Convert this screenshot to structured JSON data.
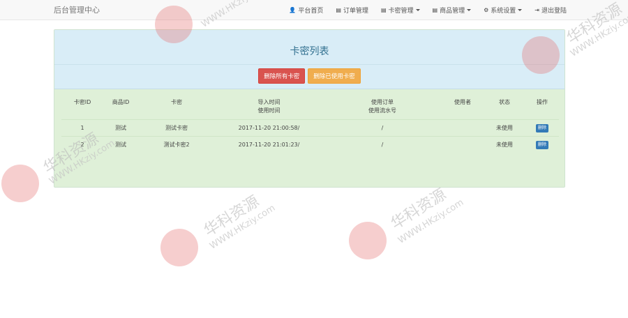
{
  "navbar": {
    "brand": "后台管理中心",
    "items": [
      {
        "icon": "user-icon",
        "glyph": "👤",
        "label": "平台首页",
        "dropdown": false
      },
      {
        "icon": "list-icon",
        "glyph": "▤",
        "label": "订单管理",
        "dropdown": false
      },
      {
        "icon": "list-icon",
        "glyph": "▤",
        "label": "卡密管理",
        "dropdown": true
      },
      {
        "icon": "list-icon",
        "glyph": "▤",
        "label": "商品管理",
        "dropdown": true
      },
      {
        "icon": "gear-icon",
        "glyph": "⚙",
        "label": "系统设置",
        "dropdown": true
      },
      {
        "icon": "logout-icon",
        "glyph": "⇥",
        "label": "退出登陆",
        "dropdown": false
      }
    ]
  },
  "panel": {
    "title": "卡密列表",
    "buttons": {
      "delete_all": "删除所有卡密",
      "delete_used": "删除已使用卡密"
    }
  },
  "table": {
    "headers": [
      [
        "卡密ID"
      ],
      [
        "商品ID"
      ],
      [
        "卡密"
      ],
      [
        "导入时间",
        "使用时间"
      ],
      [
        "使用订单",
        "使用流水号"
      ],
      [
        "使用者"
      ],
      [
        "状态"
      ],
      [
        "操作"
      ]
    ],
    "rows": [
      {
        "id": "1",
        "goods": "测试",
        "card": "测试卡密",
        "time": "2017-11-20 21:00:58/",
        "order": "/",
        "user": "",
        "status": "未使用",
        "action": "删除"
      },
      {
        "id": "2",
        "goods": "测试",
        "card": "测试卡密2",
        "time": "2017-11-20 21:01:23/",
        "order": "/",
        "user": "",
        "status": "未使用",
        "action": "删除"
      }
    ]
  },
  "watermark": {
    "text": "华科资源",
    "url": "WWW.HKziy.com"
  },
  "colors": {
    "panel_head": "#d9edf7",
    "panel_body": "#dff0d8",
    "danger": "#d9534f",
    "warning": "#f0ad4e",
    "primary": "#337ab7"
  }
}
